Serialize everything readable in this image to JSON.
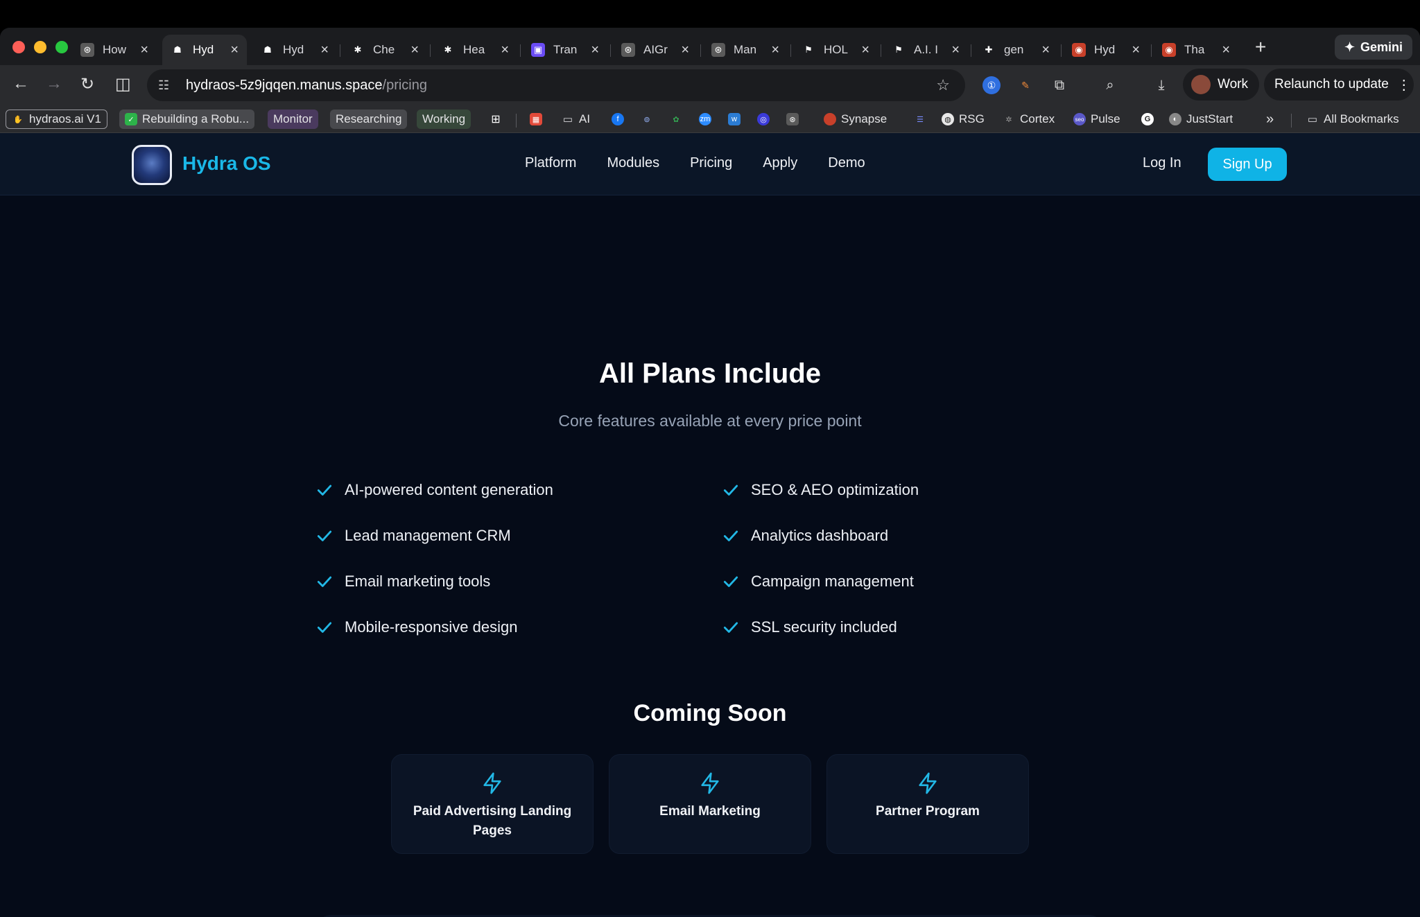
{
  "browser": {
    "tabs": [
      {
        "title": "How",
        "icon": "chatgpt-icon",
        "color": "#5a5a5a",
        "glyph": "⊛"
      },
      {
        "title": "Hyd",
        "icon": "manus-icon",
        "color": "#2a2b2e",
        "glyph": "☗"
      },
      {
        "title": "Hyd",
        "icon": "manus-icon",
        "color": "#1b1c1f",
        "glyph": "☗"
      },
      {
        "title": "Che",
        "icon": "sparkle-icon",
        "color": "#1b1c1f",
        "glyph": "✱"
      },
      {
        "title": "Hea",
        "icon": "sparkle-icon",
        "color": "#1b1c1f",
        "glyph": "✱"
      },
      {
        "title": "Tran",
        "icon": "chat-icon",
        "color": "#6a4cf5",
        "glyph": "▣"
      },
      {
        "title": "AIGr",
        "icon": "chatgpt-icon",
        "color": "#5a5a5a",
        "glyph": "⊛"
      },
      {
        "title": "Man",
        "icon": "chatgpt-icon",
        "color": "#5a5a5a",
        "glyph": "⊛"
      },
      {
        "title": "HOL",
        "icon": "flag-icon",
        "color": "#1b1c1f",
        "glyph": "⚑"
      },
      {
        "title": "A.I. I",
        "icon": "flag-icon",
        "color": "#1b1c1f",
        "glyph": "⚑"
      },
      {
        "title": "gen",
        "icon": "slack-icon",
        "color": "#1b1c1f",
        "glyph": "✚"
      },
      {
        "title": "Hyd",
        "icon": "red-orb-icon",
        "color": "#c8402a",
        "glyph": "◉"
      },
      {
        "title": "Tha",
        "icon": "red-orb-icon",
        "color": "#c8402a",
        "glyph": "◉"
      }
    ],
    "active_tab": 1,
    "new_tab": "+",
    "gemini_label": "Gemini",
    "url_host": "hydraos-5z9jqqen.manus.space",
    "url_path": "/pricing",
    "profile_label": "Work",
    "relaunch_label": "Relaunch to update",
    "bookmarks": {
      "chips": [
        {
          "label": "hydraos.ai V1",
          "style": "outlined"
        },
        {
          "label": "Rebuilding a Robu...",
          "style": "grey"
        },
        {
          "label": "Monitor",
          "style": "purple"
        },
        {
          "label": "Researching",
          "style": "grey"
        },
        {
          "label": "Working",
          "style": "green"
        }
      ],
      "ai_folder": "AI",
      "named": [
        "Synapse",
        "RSG",
        "Cortex",
        "Pulse",
        "JustStart"
      ],
      "more": "»",
      "all": "All Bookmarks"
    }
  },
  "site": {
    "brand": "Hydra OS",
    "nav": [
      "Platform",
      "Modules",
      "Pricing",
      "Apply",
      "Demo"
    ],
    "login": "Log In",
    "signup": "Sign Up",
    "accent": "#0fb3e6"
  },
  "plans": {
    "title": "All Plans Include",
    "subtitle": "Core features available at every price point",
    "left": [
      "AI-powered content generation",
      "Lead management CRM",
      "Email marketing tools",
      "Mobile-responsive design"
    ],
    "right": [
      "SEO & AEO optimization",
      "Analytics dashboard",
      "Campaign management",
      "SSL security included"
    ]
  },
  "coming_soon": {
    "title": "Coming Soon",
    "cards": [
      "Paid Advertising Landing Pages",
      "Email Marketing",
      "Partner Program"
    ]
  }
}
